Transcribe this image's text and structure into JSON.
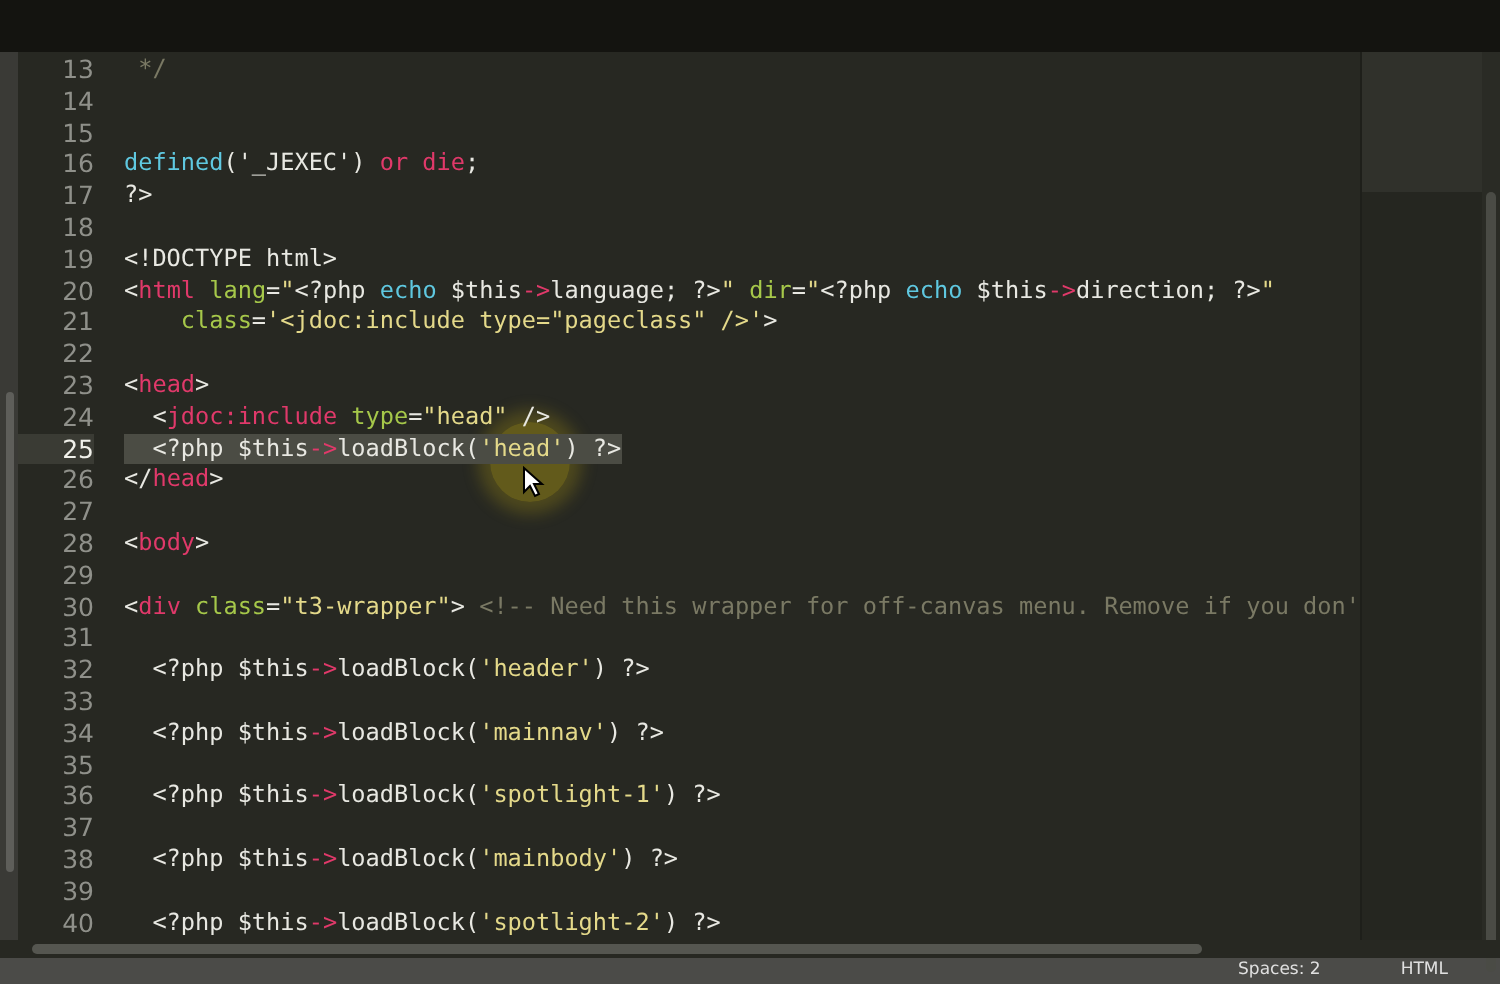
{
  "editor": {
    "lines": [
      {
        "number": "13",
        "selected": false,
        "tokens": [
          {
            "kind": "comment",
            "text": " */"
          }
        ]
      },
      {
        "number": "14",
        "selected": false
      },
      {
        "number": "15",
        "selected": false
      },
      {
        "number": "16",
        "selected": false,
        "tokens": [
          {
            "kind": "keyword",
            "text": "defined"
          },
          {
            "kind": "plain",
            "text": "('_JEXEC') "
          },
          {
            "kind": "operator",
            "text": "or die"
          },
          {
            "kind": "plain",
            "text": ";"
          }
        ]
      },
      {
        "number": "17",
        "selected": false,
        "tokens": [
          {
            "kind": "plain",
            "text": "?>"
          }
        ]
      },
      {
        "number": "18",
        "selected": false
      },
      {
        "number": "19",
        "selected": false,
        "tokens": [
          {
            "kind": "plain",
            "text": "<!DOCTYPE html>"
          }
        ]
      },
      {
        "number": "20",
        "selected": false,
        "tokens": [
          {
            "kind": "plain",
            "text": "<"
          },
          {
            "kind": "tag",
            "text": "html"
          },
          {
            "kind": "attr",
            "text": " lang"
          },
          {
            "kind": "plain",
            "text": "="
          },
          {
            "kind": "string",
            "text": "\""
          },
          {
            "kind": "plain",
            "text": "<?php "
          },
          {
            "kind": "keyword",
            "text": "echo"
          },
          {
            "kind": "plain",
            "text": " $this"
          },
          {
            "kind": "operator",
            "text": "->"
          },
          {
            "kind": "plain",
            "text": "language; ?>"
          },
          {
            "kind": "string",
            "text": "\""
          },
          {
            "kind": "attr",
            "text": " dir"
          },
          {
            "kind": "plain",
            "text": "="
          },
          {
            "kind": "string",
            "text": "\""
          },
          {
            "kind": "plain",
            "text": "<?php "
          },
          {
            "kind": "keyword",
            "text": "echo"
          },
          {
            "kind": "plain",
            "text": " $this"
          },
          {
            "kind": "operator",
            "text": "->"
          },
          {
            "kind": "plain",
            "text": "direction; ?>"
          },
          {
            "kind": "string",
            "text": "\""
          }
        ]
      },
      {
        "number": "21",
        "selected": false,
        "tokens": [
          {
            "kind": "attr",
            "text": "    class"
          },
          {
            "kind": "plain",
            "text": "="
          },
          {
            "kind": "string",
            "text": "'<jdoc:include type=\"pageclass\" />'"
          },
          {
            "kind": "plain",
            "text": ">"
          }
        ]
      },
      {
        "number": "22",
        "selected": false
      },
      {
        "number": "23",
        "selected": false,
        "tokens": [
          {
            "kind": "plain",
            "text": "<"
          },
          {
            "kind": "tag",
            "text": "head"
          },
          {
            "kind": "plain",
            "text": ">"
          }
        ]
      },
      {
        "number": "24",
        "selected": false,
        "tokens": [
          {
            "kind": "plain",
            "text": "  <"
          },
          {
            "kind": "tag",
            "text": "jdoc:include"
          },
          {
            "kind": "attr",
            "text": " type"
          },
          {
            "kind": "plain",
            "text": "="
          },
          {
            "kind": "string",
            "text": "\"head\""
          },
          {
            "kind": "plain",
            "text": " />"
          }
        ]
      },
      {
        "number": "25",
        "selected": true,
        "tokens": [
          {
            "kind": "plain",
            "text": "  <?php $this"
          },
          {
            "kind": "operator",
            "text": "->"
          },
          {
            "kind": "plain",
            "text": "loadBlock("
          },
          {
            "kind": "string",
            "text": "'head'"
          },
          {
            "kind": "plain",
            "text": ") ?>"
          }
        ]
      },
      {
        "number": "26",
        "selected": false,
        "tokens": [
          {
            "kind": "plain",
            "text": "</"
          },
          {
            "kind": "tag",
            "text": "head"
          },
          {
            "kind": "plain",
            "text": ">"
          }
        ]
      },
      {
        "number": "27",
        "selected": false
      },
      {
        "number": "28",
        "selected": false,
        "tokens": [
          {
            "kind": "plain",
            "text": "<"
          },
          {
            "kind": "tag",
            "text": "body"
          },
          {
            "kind": "plain",
            "text": ">"
          }
        ]
      },
      {
        "number": "29",
        "selected": false
      },
      {
        "number": "30",
        "selected": false,
        "tokens": [
          {
            "kind": "plain",
            "text": "<"
          },
          {
            "kind": "tag",
            "text": "div"
          },
          {
            "kind": "attr",
            "text": " class"
          },
          {
            "kind": "plain",
            "text": "="
          },
          {
            "kind": "string",
            "text": "\"t3-wrapper\""
          },
          {
            "kind": "plain",
            "text": ">"
          },
          {
            "kind": "comment",
            "text": " <!-- Need this wrapper for off-canvas menu. Remove if you don'"
          }
        ]
      },
      {
        "number": "31",
        "selected": false
      },
      {
        "number": "32",
        "selected": false,
        "tokens": [
          {
            "kind": "plain",
            "text": "  <?php $this"
          },
          {
            "kind": "operator",
            "text": "->"
          },
          {
            "kind": "plain",
            "text": "loadBlock("
          },
          {
            "kind": "string",
            "text": "'header'"
          },
          {
            "kind": "plain",
            "text": ") ?>"
          }
        ]
      },
      {
        "number": "33",
        "selected": false
      },
      {
        "number": "34",
        "selected": false,
        "tokens": [
          {
            "kind": "plain",
            "text": "  <?php $this"
          },
          {
            "kind": "operator",
            "text": "->"
          },
          {
            "kind": "plain",
            "text": "loadBlock("
          },
          {
            "kind": "string",
            "text": "'mainnav'"
          },
          {
            "kind": "plain",
            "text": ") ?>"
          }
        ]
      },
      {
        "number": "35",
        "selected": false
      },
      {
        "number": "36",
        "selected": false,
        "tokens": [
          {
            "kind": "plain",
            "text": "  <?php $this"
          },
          {
            "kind": "operator",
            "text": "->"
          },
          {
            "kind": "plain",
            "text": "loadBlock("
          },
          {
            "kind": "string",
            "text": "'spotlight-1'"
          },
          {
            "kind": "plain",
            "text": ") ?>"
          }
        ]
      },
      {
        "number": "37",
        "selected": false
      },
      {
        "number": "38",
        "selected": false,
        "tokens": [
          {
            "kind": "plain",
            "text": "  <?php $this"
          },
          {
            "kind": "operator",
            "text": "->"
          },
          {
            "kind": "plain",
            "text": "loadBlock("
          },
          {
            "kind": "string",
            "text": "'mainbody'"
          },
          {
            "kind": "plain",
            "text": ") ?>"
          }
        ]
      },
      {
        "number": "39",
        "selected": false
      },
      {
        "number": "40",
        "selected": false,
        "tokens": [
          {
            "kind": "plain",
            "text": "  <?php $this"
          },
          {
            "kind": "operator",
            "text": "->"
          },
          {
            "kind": "plain",
            "text": "loadBlock("
          },
          {
            "kind": "string",
            "text": "'spotlight-2'"
          },
          {
            "kind": "plain",
            "text": ") ?>"
          }
        ]
      }
    ]
  },
  "status_bar": {
    "indentation": "Spaces: 2",
    "syntax": "HTML"
  }
}
